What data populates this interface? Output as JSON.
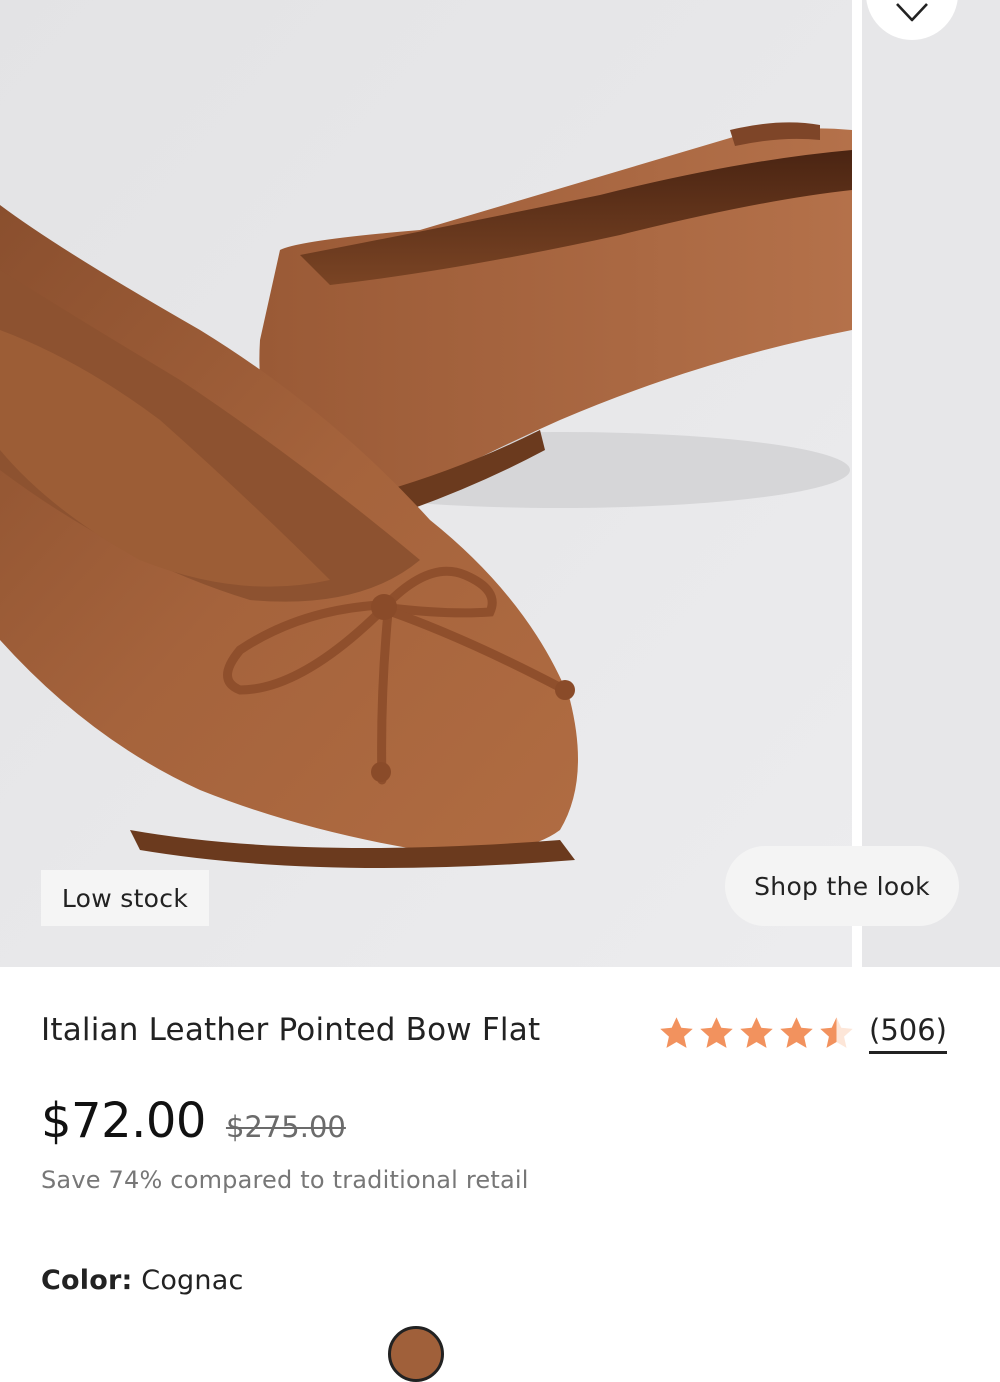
{
  "gallery": {
    "image_alt": "Italian Leather Pointed Bow Flat in Cognac",
    "badge": "Low stock",
    "shop_look_label": "Shop the look",
    "favorite_icon": "heart-icon"
  },
  "product": {
    "title": "Italian Leather Pointed Bow Flat",
    "rating": {
      "value": 4.5,
      "max": 5,
      "count_label": "(506)",
      "star_color": "#F2925E"
    },
    "price": "$72.00",
    "compare_price": "$275.00",
    "save_note": "Save 74% compared to traditional retail",
    "color": {
      "label": "Color:",
      "value": "Cognac",
      "swatch_color": "#A0603A"
    }
  }
}
